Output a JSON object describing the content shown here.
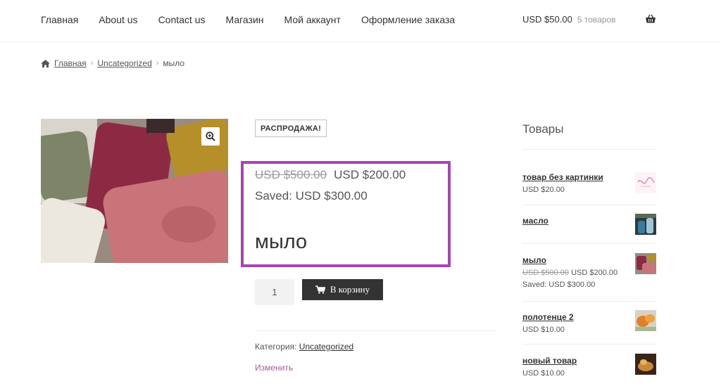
{
  "nav": {
    "items": [
      "Главная",
      "About us",
      "Contact us",
      "Магазин",
      "Мой аккаунт",
      "Оформление заказа"
    ]
  },
  "cart": {
    "total": "USD $50.00",
    "count": "5 товаров",
    "icon": "basket-icon"
  },
  "breadcrumb": {
    "home": "Главная",
    "category": "Uncategorized",
    "sep": "›",
    "current": "мыло"
  },
  "product": {
    "badge": "РАСПРОДАЖА!",
    "price_old": "USD $500.00",
    "price_new": "USD $200.00",
    "saved": "Saved: USD $300.00",
    "title": "мыло",
    "quantity": "1",
    "add_to_cart": "В корзину",
    "category_label": "Категория:",
    "category_value": "Uncategorized",
    "edit": "Изменить"
  },
  "sidebar": {
    "title": "Товары",
    "items": [
      {
        "name": "товар без картинки",
        "price": "USD $20.00"
      },
      {
        "name": "масло"
      },
      {
        "name": "мыло",
        "price_old": "USD $500.00",
        "price_new": "USD $200.00",
        "saved": "Saved: USD $300.00"
      },
      {
        "name": "полотенце 2",
        "price": "USD $10.00"
      },
      {
        "name": "новый товар",
        "price": "USD $10.00"
      }
    ]
  },
  "colors": {
    "accent": "#a348ae",
    "button": "#333333",
    "edit_link": "#a45a9c"
  }
}
